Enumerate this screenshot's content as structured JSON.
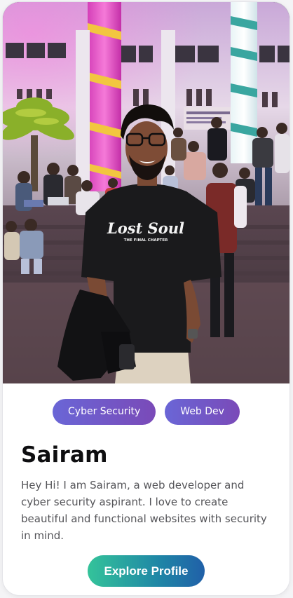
{
  "profile": {
    "tags": [
      "Cyber Security",
      "Web Dev"
    ],
    "name": "Sairam",
    "bio": "Hey Hi! I am Sairam, a web developer and cyber security aspirant. I love to create beautiful and functional websites with security in mind.",
    "cta_label": "Explore Profile",
    "shirt_print": {
      "line1": "Lost Soul",
      "line2": "THE FINAL CHAPTER"
    }
  },
  "colors": {
    "tag_gradient_start": "#6a66d6",
    "tag_gradient_end": "#7a4ab8",
    "cta_gradient_start": "#34c39a",
    "cta_gradient_end": "#2060a8",
    "name": "#0e0e10",
    "bio": "#555559"
  }
}
